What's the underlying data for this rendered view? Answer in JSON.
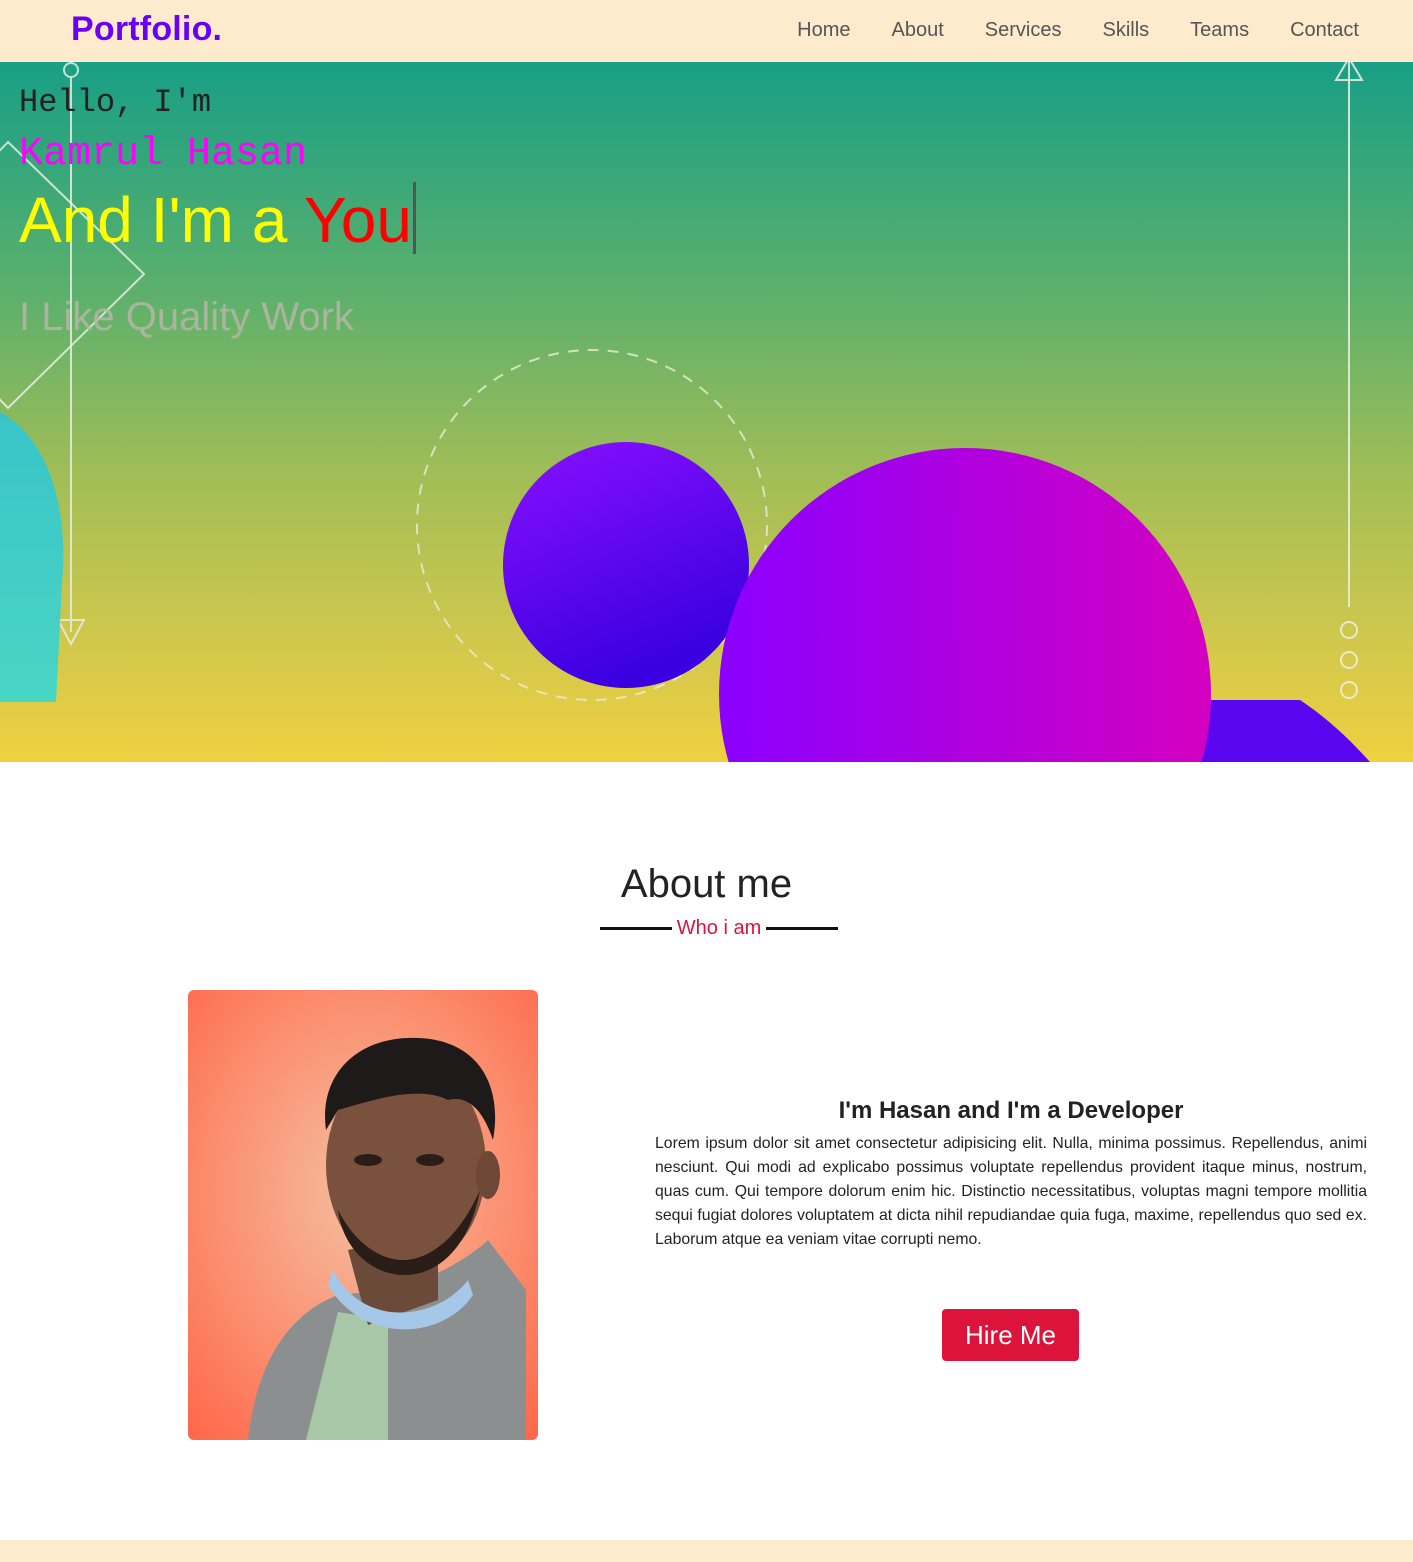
{
  "navbar": {
    "logo": "Portfolio.",
    "links": [
      "Home",
      "About",
      "Services",
      "Skills",
      "Teams",
      "Contact"
    ]
  },
  "hero": {
    "greeting": "Hello, I'm",
    "name": "Kamrul Hasan",
    "role_prefix": "And I'm a ",
    "role_word": "You",
    "tagline": "I Like Quality Work"
  },
  "about": {
    "title": "About me",
    "subtitle": "Who i am",
    "heading": "I'm Hasan and I'm a Developer",
    "paragraph": "Lorem ipsum dolor sit amet consectetur adipisicing elit. Nulla, minima possimus. Repellendus, animi nesciunt. Qui modi ad explicabo possimus voluptate repellendus provident itaque minus, nostrum, quas cum. Qui tempore dolorum enim hic. Distinctio necessitatibus, voluptas magni tempore mollitia sequi fugiat dolores voluptatem at dicta nihil repudiandae quia fuga, maxime, repellendus quo sed ex. Laborum atque ea veniam vitae corrupti nemo.",
    "button": "Hire Me"
  },
  "colors": {
    "brand": "#6a00f4",
    "navbar_bg": "#feebcd",
    "accent": "#dc143c",
    "name_color": "#ff00ff",
    "role_color": "#ffff00",
    "role_word_color": "#ff0000"
  }
}
